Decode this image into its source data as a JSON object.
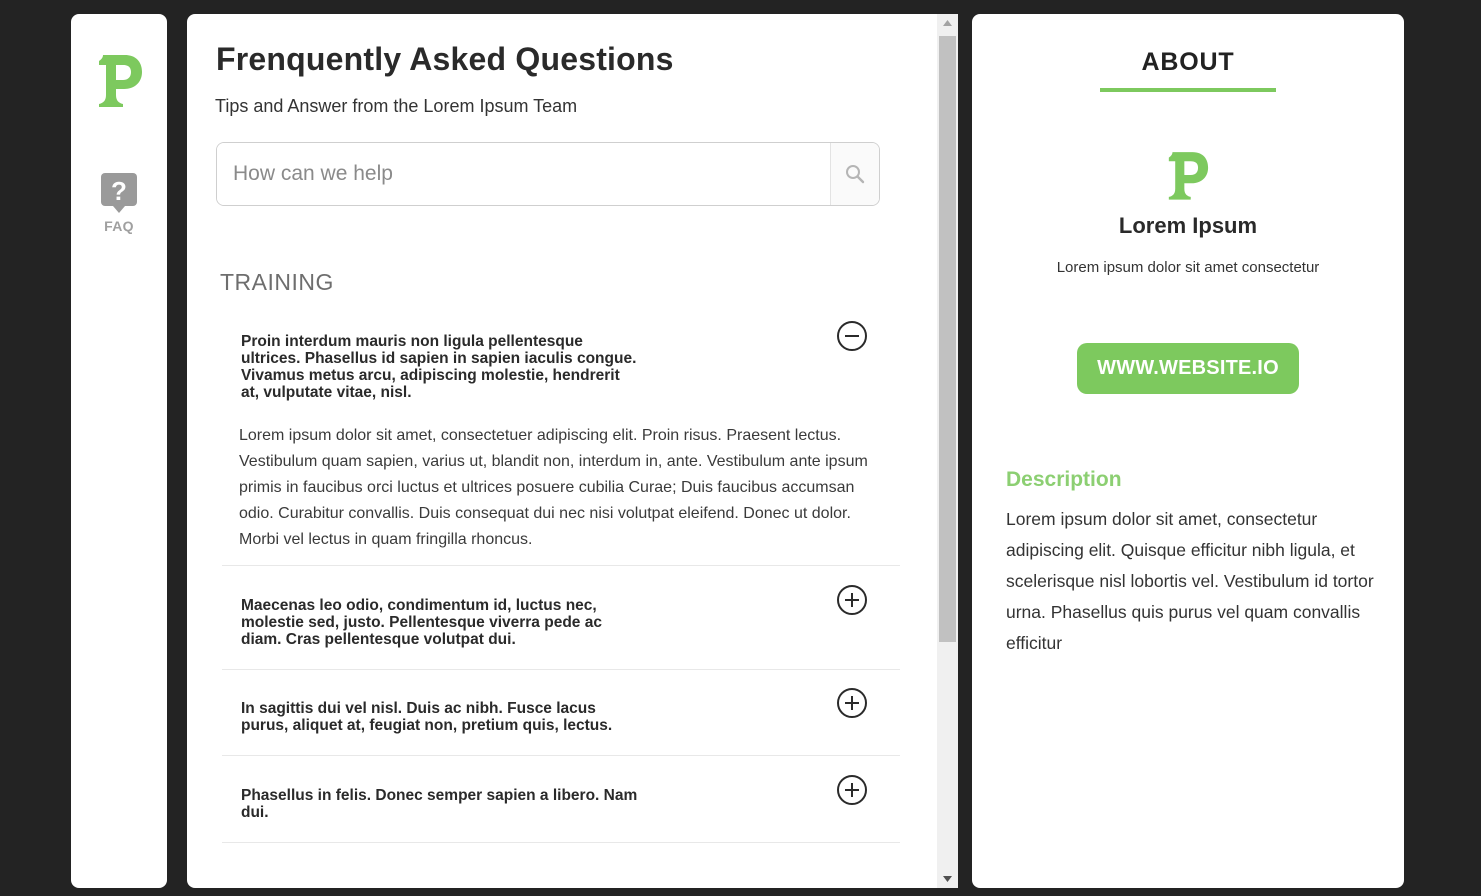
{
  "nav": {
    "faq_label": "FAQ"
  },
  "main": {
    "title": "Frenquently Asked Questions",
    "subtitle": "Tips and Answer from the Lorem Ipsum Team",
    "search": {
      "placeholder": "How can we help",
      "value": ""
    },
    "section": "TRAINING",
    "faqs": [
      {
        "question": "Proin interdum mauris non ligula pellentesque ultrices. Phasellus id sapien in sapien iaculis congue. Vivamus metus arcu, adipiscing molestie, hendrerit at, vulputate vitae, nisl.",
        "answer": "Lorem ipsum dolor sit amet, consectetuer adipiscing elit. Proin risus. Praesent lectus. Vestibulum quam sapien, varius ut, blandit non, interdum in, ante. Vestibulum ante ipsum primis in faucibus orci luctus et ultrices posuere cubilia Curae; Duis faucibus accumsan odio. Curabitur convallis. Duis consequat dui nec nisi volutpat eleifend. Donec ut dolor. Morbi vel lectus in quam fringilla rhoncus.",
        "expanded": true
      },
      {
        "question": "Maecenas leo odio, condimentum id, luctus nec, molestie sed, justo. Pellentesque viverra pede ac diam. Cras pellentesque volutpat dui.",
        "expanded": false
      },
      {
        "question": "In sagittis dui vel nisl. Duis ac nibh. Fusce lacus purus, aliquet at, feugiat non, pretium quis, lectus.",
        "expanded": false
      },
      {
        "question": "Phasellus in felis. Donec semper sapien a libero. Nam dui.",
        "expanded": false
      }
    ]
  },
  "about": {
    "title": "ABOUT",
    "name": "Lorem Ipsum",
    "tagline": "Lorem ipsum dolor sit amet consectetur",
    "website_label": "WWW.WEBSITE.IO",
    "description_heading": "Description",
    "description": "Lorem ipsum dolor sit amet, consectetur adipiscing elit. Quisque efficitur nibh ligula, et scelerisque nisl lobortis vel. Vestibulum id tortor urna. Phasellus quis purus vel quam convallis efficitur"
  },
  "icons": {
    "logo": "p-logo-icon",
    "faq": "question-bubble-icon",
    "search": "search-icon",
    "collapse": "minus-circle-icon",
    "expand": "plus-circle-icon"
  },
  "colors": {
    "brand_green": "#7dc95e",
    "background": "#232323"
  }
}
